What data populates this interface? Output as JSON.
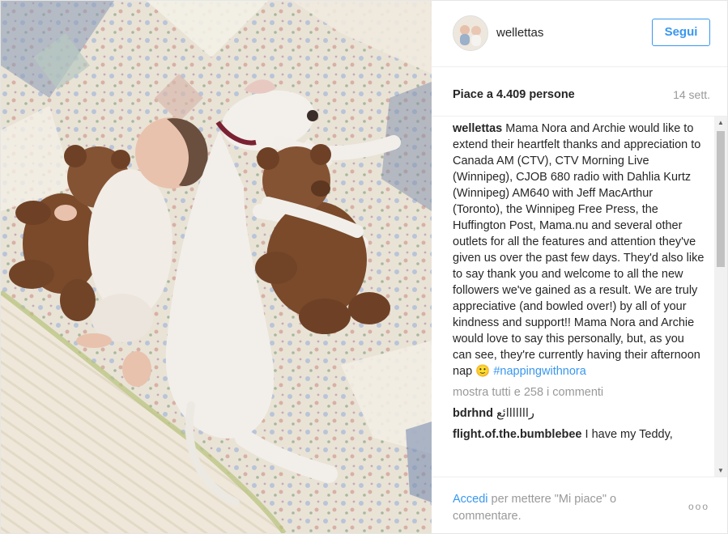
{
  "header": {
    "username": "wellettas",
    "follow_label": "Segui"
  },
  "stats": {
    "likes": "Piace a 4.409 persone",
    "date": "14 sett."
  },
  "caption": {
    "author": "wellettas",
    "text": "Mama Nora and Archie would like to extend their heartfelt thanks and appreciation to Canada AM (CTV), CTV Morning Live (Winnipeg), CJOB 680 radio with Dahlia Kurtz (Winnipeg) AM640 with Jeff MacArthur (Toronto), the Winnipeg Free Press, the Huffington Post, Mama.nu and several other outlets for all the features and attention they've given us over the past few days. They'd also like to say thank you and welcome to all the new followers we've gained as a result. We are truly appreciative (and bowled over!) by all of your kindness and support!! Mama Nora and Archie would love to say this personally, but, as you can see, they're currently having their afternoon nap",
    "emoji": "🙂",
    "hashtag": "#nappingwithnora"
  },
  "more_comments": "mostra tutti e 258 i commenti",
  "comments": [
    {
      "author": "bdrhnd",
      "text": "رااااااائع"
    },
    {
      "author": "flight.of.the.bumblebee",
      "text": "I have my Teddy,"
    }
  ],
  "footer": {
    "login_link": "Accedi",
    "login_text": " per mettere \"Mi piace\" o commentare.",
    "more_options": "ooo"
  },
  "colors": {
    "accent": "#3897f0",
    "muted": "#999999",
    "text": "#262626"
  }
}
